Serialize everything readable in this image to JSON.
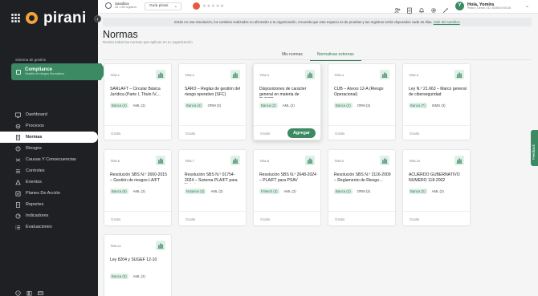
{
  "brand": {
    "name": "pirani",
    "accent": "#3b8a63",
    "logo_color": "#f2a23a"
  },
  "sidebar": {
    "system_label": "Sistema de gestión",
    "system_name": "Compliance",
    "system_sub": "Gestión de riesgos Normativos",
    "items": [
      {
        "label": "Dashboard",
        "icon": "dashboard-icon",
        "active": false
      },
      {
        "label": "Procesos",
        "icon": "process-icon",
        "active": false
      },
      {
        "label": "Normas",
        "icon": "document-icon",
        "active": true
      },
      {
        "label": "Riesgos",
        "icon": "risk-icon",
        "active": false
      },
      {
        "label": "Causas Y Consecuencias",
        "icon": "cause-icon",
        "active": false
      },
      {
        "label": "Controles",
        "icon": "controls-icon",
        "active": false
      },
      {
        "label": "Eventos",
        "icon": "events-icon",
        "active": false
      },
      {
        "label": "Planes De Acción",
        "icon": "action-plan-icon",
        "active": false
      },
      {
        "label": "Reportes",
        "icon": "reports-icon",
        "active": false
      },
      {
        "label": "Indicadores",
        "icon": "indicators-icon",
        "active": false
      },
      {
        "label": "Evaluaciones",
        "icon": "evaluations-icon",
        "active": false
      }
    ]
  },
  "topbar": {
    "sandbox_title": "Sandbox",
    "sandbox_sub": "36 / 150 registros",
    "guide_label": "Guía pirani",
    "user_name": "Hola, Yomira",
    "user_sub": "Pirani | Demo • ID: 3008XXXX416",
    "user_initial": "Y"
  },
  "banner": {
    "text": "Estás en una simulación, los cambios realizados no afectarán a tu organización, recuerda que este espacio es de pruebas y tus registros serán depurados cada 15 días.",
    "link": "Salir del sandbox"
  },
  "page": {
    "title": "Normas",
    "subtitle": "Revisa todas las normas que aplican en tu organización"
  },
  "tabs": [
    {
      "label": "Mis normas",
      "active": false
    },
    {
      "label": "Normativas externas",
      "active": true
    }
  ],
  "cards": [
    {
      "tag": "TEM-1",
      "title": "SARLAFT – Circular Básica Jurídica (Parte I, Título IV,...",
      "chips": [
        "Banca (4)",
        "AML (2)"
      ],
      "price": "Gratis"
    },
    {
      "tag": "TEM-2",
      "title": "SARO – Reglas de gestión del riesgo operativo (SFC)",
      "chips": [
        "Banca (4)",
        "ORM (3)"
      ],
      "price": "Gratis"
    },
    {
      "tag": "TEM-3",
      "title": "Disposiciones de carácter general en materia de PLD/FT...",
      "chips": [
        "Banca (2)",
        "AML (2)"
      ],
      "price": "Gratis",
      "button": "Agregar"
    },
    {
      "tag": "TEM-4",
      "title": "CUB – Anexo 12-A (Riesgo Operacional)",
      "chips": [
        "Banca (2)",
        "ORM (3)"
      ],
      "price": "Gratis"
    },
    {
      "tag": "TEM-5",
      "title": "Ley N.º 21.663 – Marco general de ciberseguridad",
      "chips": [
        "Banca (7)",
        "ISMS (3)"
      ],
      "price": "Gratis"
    },
    {
      "tag": "TEM-6",
      "title": "Resolución SBS N.º 2660-2015 – Gestión de riesgos LA/FT",
      "chips": [
        "Banca (8)",
        "AML (2)"
      ],
      "price": "Gratis"
    },
    {
      "tag": "TEM-7",
      "title": "Resolución SBS N.º 01754-2024 – Sistema PLA/FT para Notarios",
      "chips": [
        "Notarios (2)",
        "AML (2)"
      ],
      "price": "Gratis"
    },
    {
      "tag": "TEM-8",
      "title": "Resolución SBS N.º 2648-2024 – PLA/FT para PSAV",
      "chips": [
        "Fintech (2)",
        "AML (2)"
      ],
      "price": "Gratis"
    },
    {
      "tag": "TEM-9",
      "title": "Resolución SBS N.º 2116-2009 – Reglamento de Riesgo...",
      "chips": [
        "Banca (2)",
        "ORM (3)"
      ],
      "price": "Gratis"
    },
    {
      "tag": "TEM-10",
      "title": "ACUERDO GUBERNATIVO NUMERO 118-2002",
      "chips": [
        "Banca (2)",
        "AML (2)"
      ],
      "price": "Gratis"
    },
    {
      "tag": "TEM-11",
      "title": "Ley 8204 y SUGEF 12-10",
      "chips": [
        "Banca (3)",
        "AML (2)"
      ],
      "price": ""
    }
  ],
  "feedback_label": "Feedback"
}
